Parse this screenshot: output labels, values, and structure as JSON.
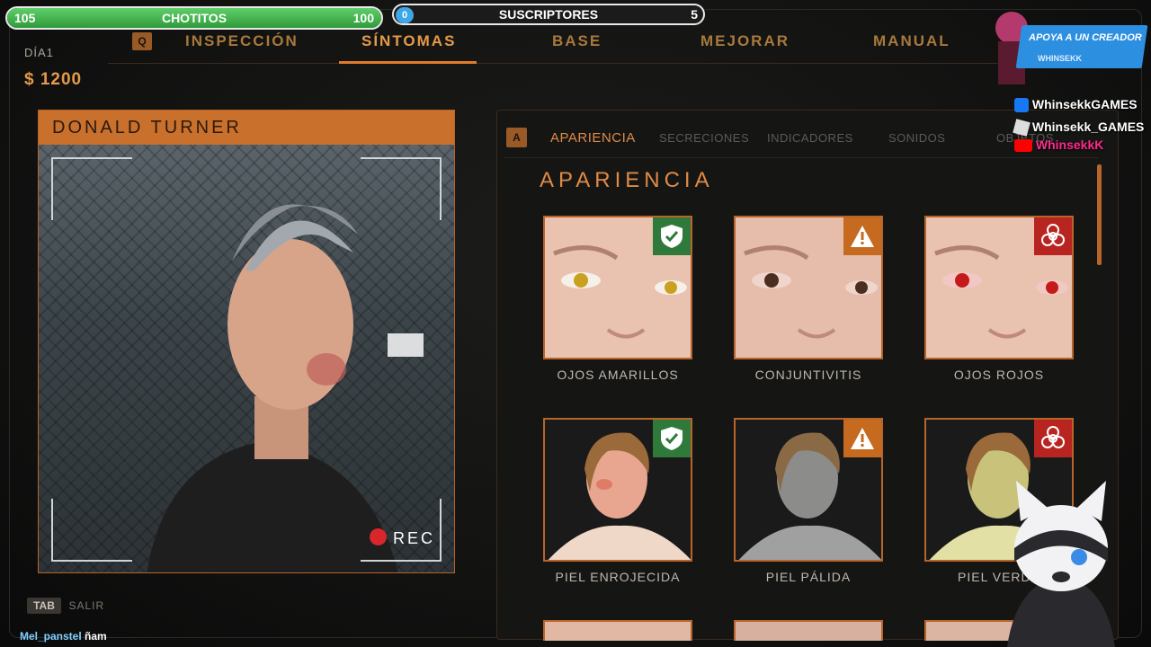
{
  "overlay": {
    "goal_bar": {
      "start": "105",
      "label": "CHOTITOS",
      "end": "100"
    },
    "subs_bar": {
      "start": "0",
      "label": "SUSCRIPTORES",
      "end": "5"
    },
    "promo": {
      "title": "APOYA A UN CREADOR",
      "handle": "WHINSEKK"
    },
    "socials": [
      {
        "platform": "facebook",
        "label": "WhinsekkGAMES"
      },
      {
        "platform": "roblox",
        "label": "Whinsekk_GAMES"
      },
      {
        "platform": "youtube",
        "label": "WhinsekkK"
      }
    ],
    "chat": {
      "user": "Mel_panstel",
      "message": "ñam"
    }
  },
  "hud": {
    "day": "DÍA1",
    "money": "$ 1200",
    "nav_key_left": "Q",
    "nav_tabs": [
      "INSPECCIÓN",
      "SÍNTOMAS",
      "BASE",
      "MEJORAR",
      "MANUAL"
    ],
    "active_tab": "SÍNTOMAS",
    "exit_key": "TAB",
    "exit_label": "SALIR"
  },
  "patient": {
    "name": "DONALD TURNER",
    "rec_label": "REC"
  },
  "symptoms": {
    "key": "A",
    "subtabs": [
      "APARIENCIA",
      "SECRECIONES",
      "INDICADORES",
      "SONIDOS",
      "OBJETOS"
    ],
    "active_subtab": "APARIENCIA",
    "section_title": "APARIENCIA",
    "cards": [
      {
        "label": "OJOS AMARILLOS",
        "status": "safe",
        "icon": "shield-check-icon"
      },
      {
        "label": "CONJUNTIVITIS",
        "status": "warn",
        "icon": "warning-icon"
      },
      {
        "label": "OJOS ROJOS",
        "status": "bio",
        "icon": "biohazard-icon"
      },
      {
        "label": "PIEL ENROJECIDA",
        "status": "safe",
        "icon": "shield-check-icon"
      },
      {
        "label": "PIEL PÁLIDA",
        "status": "warn",
        "icon": "warning-icon"
      },
      {
        "label": "PIEL VERDE",
        "status": "bio",
        "icon": "biohazard-icon"
      }
    ]
  },
  "colors": {
    "accent": "#e08a45",
    "panel_border": "#b8642a",
    "safe": "#2f7a3a",
    "warn": "#c56a1e",
    "bio": "#b82420"
  }
}
